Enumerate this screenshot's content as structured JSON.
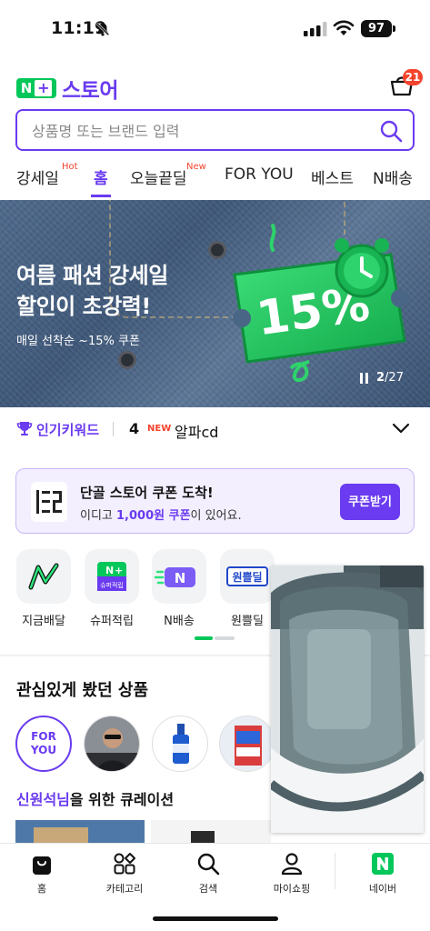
{
  "status_bar": {
    "time": "11:19",
    "battery": "97"
  },
  "header": {
    "logo_badge": "N",
    "logo_plus": "+",
    "logo_text": "스토어",
    "cart_count": "21",
    "accent_color": "#6a3bf0",
    "naver_green": "#03c75a"
  },
  "search": {
    "placeholder": "상품명 또는 브랜드 입력"
  },
  "tabs": [
    {
      "label": "강세일",
      "sup": "Hot"
    },
    {
      "label": "홈",
      "active": true
    },
    {
      "label": "오늘끝딜",
      "sup": "New"
    },
    {
      "label": "FOR YOU"
    },
    {
      "label": "베스트"
    },
    {
      "label": "N배송"
    }
  ],
  "banner": {
    "title_line1": "여름 패션 강세일",
    "title_line2": "할인이 초강력!",
    "subtitle": "매일 선착순 ~15% 쿠폰",
    "coupon_text": "15%",
    "page_current": "2",
    "page_total": "/27"
  },
  "keywords": {
    "title": "인기키워드",
    "rank": "4",
    "new_badge": "NEW",
    "keyword": "알파cd"
  },
  "coupon": {
    "title": "단골 스토어 쿠폰 도착!",
    "desc_prefix": "이디고 ",
    "desc_highlight": "1,000원 쿠폰",
    "desc_suffix": "이 있어요.",
    "button": "쿠폰받기"
  },
  "shortcuts": [
    {
      "label": "지금배달",
      "icon": "delivery-icon"
    },
    {
      "label": "슈퍼적립",
      "icon": "super-points-icon",
      "badge": "슈퍼적립"
    },
    {
      "label": "N배송",
      "icon": "n-delivery-icon"
    },
    {
      "label": "원쁠딜",
      "icon": "one-plus-deal-icon",
      "badge": "원쁠딜"
    }
  ],
  "recently_viewed": {
    "title": "관심있게 봤던 상품",
    "for_you": "FOR\nYOU"
  },
  "curation": {
    "name": "신원석님",
    "suffix": "을 위한 큐레이션"
  },
  "bottom_nav": [
    {
      "label": "홈",
      "icon": "home-bag-icon"
    },
    {
      "label": "카테고리",
      "icon": "category-icon"
    },
    {
      "label": "검색",
      "icon": "search-icon"
    },
    {
      "label": "마이쇼핑",
      "icon": "person-icon"
    },
    {
      "label": "네이버",
      "icon": "naver-n-icon"
    }
  ]
}
